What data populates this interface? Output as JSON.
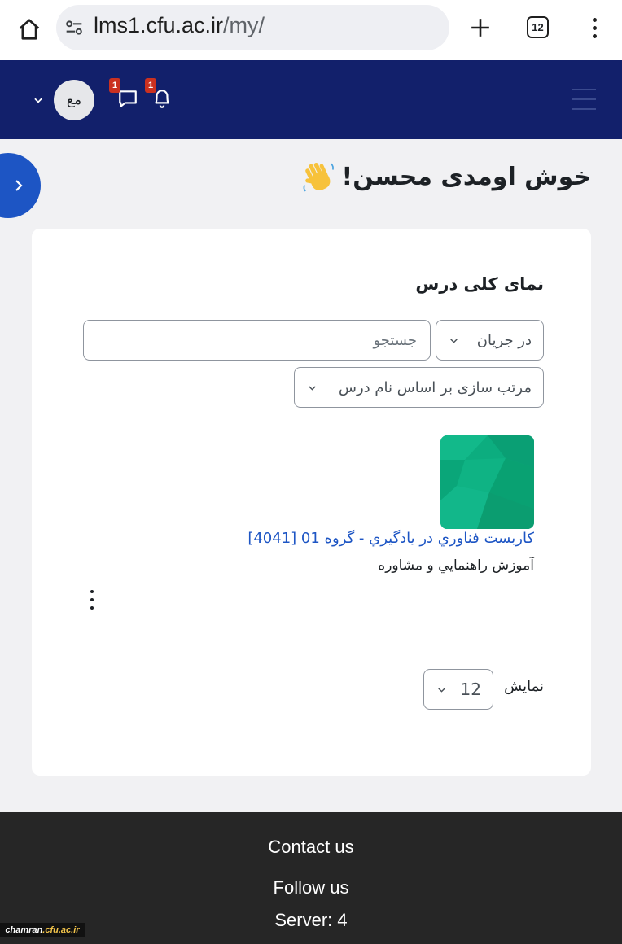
{
  "browser": {
    "url_host": "lms1.cfu.ac.ir",
    "url_path": "/my/",
    "tab_count": "12"
  },
  "navbar": {
    "user_initials": "مع",
    "messages_badge": "1",
    "notifications_badge": "1",
    "brand_color": "#12206b"
  },
  "greeting": {
    "text": "خوش اومدی محسن!",
    "icon": "waving-hand-icon"
  },
  "course_overview": {
    "title": "نمای کلی درس",
    "status_filter": "در جریان",
    "search_placeholder": "جستجو",
    "sort_option": "مرتب سازی بر اساس نام درس",
    "courses": [
      {
        "name": "كاربست فناوري در يادگيري - گروه 01 [4041]",
        "category": "آموزش راهنمايي و مشاوره",
        "image_color": "#0cad7f"
      }
    ],
    "show_label": "نمایش",
    "per_page": "12"
  },
  "footer": {
    "contact": "Contact us",
    "follow": "Follow us",
    "server": "Server: 4"
  },
  "watermark": {
    "site": "chamran",
    "domain": ".cfu.ac.ir"
  }
}
